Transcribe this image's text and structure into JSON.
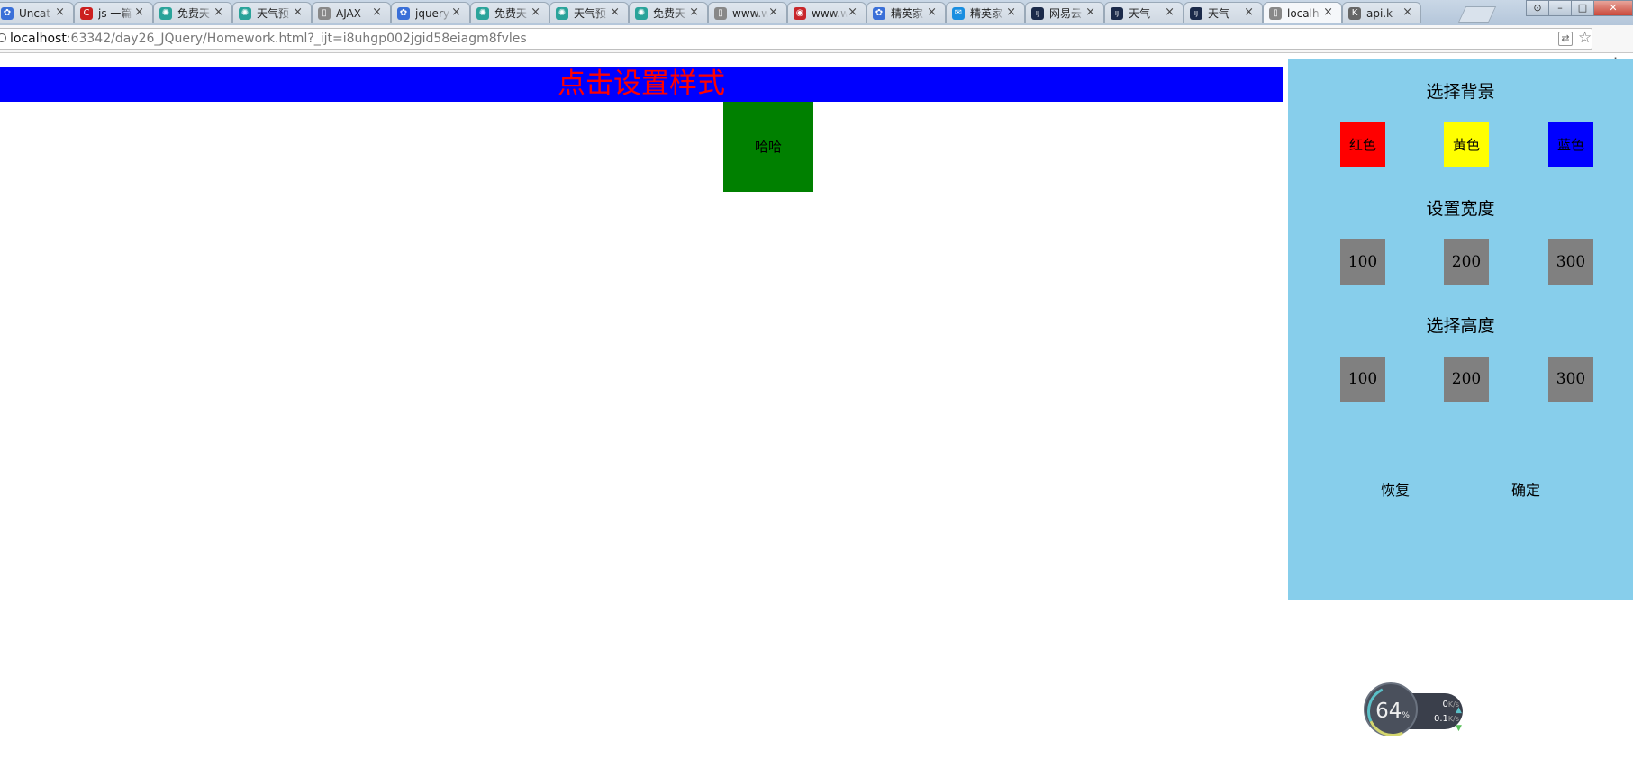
{
  "browser": {
    "tabs": [
      {
        "title": "Uncat",
        "icon": "paw-icon",
        "color": "#3a6fd8"
      },
      {
        "title": "js 一篇",
        "icon": "c-logo-icon",
        "color": "#cc1f1f"
      },
      {
        "title": "免费天",
        "icon": "gear-icon",
        "color": "#2aa39a"
      },
      {
        "title": "天气预",
        "icon": "gear-icon",
        "color": "#2aa39a"
      },
      {
        "title": "AJAX",
        "icon": "page-icon",
        "color": "#888888"
      },
      {
        "title": "jquery",
        "icon": "paw-icon",
        "color": "#3a6fd8"
      },
      {
        "title": "免费天",
        "icon": "gear-icon",
        "color": "#2aa39a"
      },
      {
        "title": "天气预",
        "icon": "gear-icon",
        "color": "#2aa39a"
      },
      {
        "title": "免费天",
        "icon": "gear-icon",
        "color": "#2aa39a"
      },
      {
        "title": "www.w",
        "icon": "page-icon",
        "color": "#888888"
      },
      {
        "title": "www.w",
        "icon": "red-logo-icon",
        "color": "#c8262b"
      },
      {
        "title": "精英家",
        "icon": "paw-icon",
        "color": "#3a6fd8"
      },
      {
        "title": "精英家",
        "icon": "chat-icon",
        "color": "#1a8ee0"
      },
      {
        "title": "网易云",
        "icon": "ij-icon",
        "color": "#1b2a4a"
      },
      {
        "title": "天气",
        "icon": "ij-icon",
        "color": "#1b2a4a"
      },
      {
        "title": "天气",
        "icon": "ij-icon",
        "color": "#1b2a4a"
      },
      {
        "title": "localh",
        "icon": "page-icon",
        "color": "#888888"
      },
      {
        "title": "api.k",
        "icon": "k-logo-icon",
        "color": "#666666"
      }
    ],
    "window_buttons": {
      "minimize": "–",
      "maximize": "□",
      "close": "✕",
      "user": "⊙"
    },
    "url": {
      "host": "localhost",
      "rest": ":63342/day26_JQuery/Homework.html?_ijt=i8uhgp002jgid58eiagm8fvles"
    }
  },
  "page": {
    "banner_text": "点击设置样式",
    "box_text": "哈哈",
    "colors": {
      "banner_bg": "#0000ff",
      "banner_text": "#ff0000",
      "box_bg": "#008000",
      "panel_bg": "#87ceeb",
      "option_gray": "#808080"
    },
    "panel": {
      "background_heading": "选择背景",
      "background_options": [
        {
          "label": "红色",
          "color": "#ff0000"
        },
        {
          "label": "黄色",
          "color": "#ffff00"
        },
        {
          "label": "蓝色",
          "color": "#0000ff"
        }
      ],
      "width_heading": "设置宽度",
      "width_options": [
        "100",
        "200",
        "300"
      ],
      "height_heading": "选择高度",
      "height_options": [
        "100",
        "200",
        "300"
      ],
      "reset_label": "恢复",
      "confirm_label": "确定"
    }
  },
  "speed_widget": {
    "percent": "64",
    "percent_unit": "%",
    "upload": "0",
    "download": "0.1",
    "unit": "K/s"
  }
}
